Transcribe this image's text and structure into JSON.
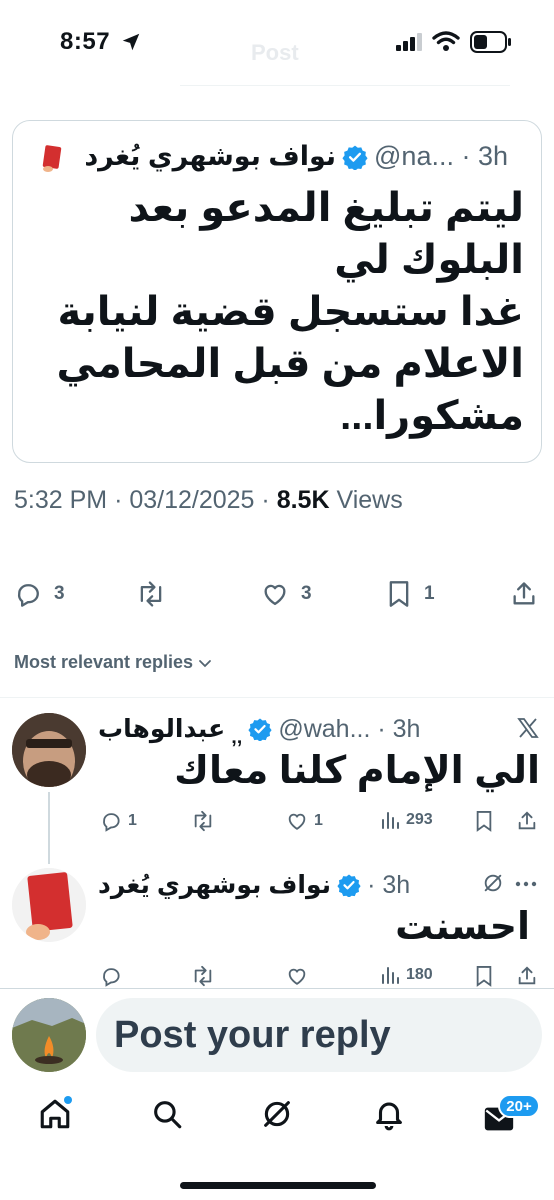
{
  "status_bar": {
    "time": "8:57"
  },
  "header": {
    "title": "Post"
  },
  "quoted_post": {
    "name": "نواف بوشهري يُغرد",
    "handle_time": "@na... · 3h",
    "body_lines": [
      "ليتم تبليغ المدعو بعد",
      "البلوك لي",
      "غدا ستسجل قضية لنيابة",
      "الاعلام من قبل المحامي",
      "مشكورا..."
    ]
  },
  "post_meta": {
    "time": "5:32 PM",
    "date": "03/12/2025",
    "views": "8.5K",
    "views_label": "Views"
  },
  "actions": {
    "replies": "3",
    "likes": "3",
    "bookmarks": "1"
  },
  "sort": {
    "label": "Most relevant replies"
  },
  "replies": [
    {
      "name": "عبدالوهاب",
      "name_suffix": "‚‚",
      "handle_time": "@wah... · 3h",
      "text": "الي الإمام كلنا معاك",
      "replies": "1",
      "likes": "1",
      "views": "293"
    },
    {
      "name": "نواف بوشهري يُغرد",
      "handle_time": "· 3h",
      "text": "احسنت",
      "views": "180"
    }
  ],
  "composer": {
    "placeholder": "Post your reply"
  },
  "tab_bar": {
    "messages_badge": "20+"
  },
  "colors": {
    "accent": "#1d9bf0",
    "text": "#0f1419",
    "muted": "#536471",
    "card_red": "#d32f2f"
  }
}
